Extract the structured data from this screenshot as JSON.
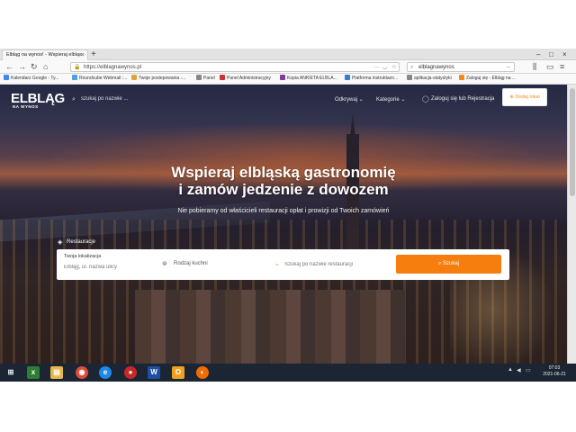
{
  "browser": {
    "tab_title": "Elbląg na wynos! - Wspieraj elbląs",
    "url": "https://elblagnawynos.pl",
    "search_value": "elblagnawynos",
    "bookmarks": [
      "Kalendarz Google - Ty...",
      "Roundcube Webmail :...",
      "Twoje postepowania -...",
      "Panel",
      "Panel Administracyjny",
      "Kopia ANKIETA ELBLA...",
      "Platforma instruktazo...",
      "aplikacja-statystyki",
      "Zaloguj się - Elbląg na ..."
    ]
  },
  "site": {
    "logo_main": "ELBLĄG",
    "logo_sub": "NA WYNOS",
    "top_search_placeholder": "szukaj po nazwie ...",
    "nav_discover": "Odkrywaj",
    "nav_categories": "Kategorie",
    "login_text": "Zaloguj się lub Rejestracja",
    "add_place_button": "Dodaj lokal"
  },
  "hero": {
    "title_line1": "Wspieraj elbląską gastronomię",
    "title_line2": "i zamów jedzenie z dowozem",
    "subtitle": "Nie pobieramy od właścicieli restauracji opłat i prowizji od Twoich zamówień"
  },
  "search_panel": {
    "section_label": "Restauracje",
    "location_label": "Twoja lokalizacja",
    "location_placeholder": "Elbląg, ul. nazwa ulicy",
    "cuisine_placeholder": "Rodzaj kuchni",
    "name_placeholder": "Szukaj po nazwie restauracji",
    "search_button": "Szukaj"
  },
  "taskbar": {
    "time": "07:03",
    "date": "2021-06-21"
  },
  "colors": {
    "accent": "#f57e0f",
    "taskbar": "#1b2533"
  }
}
